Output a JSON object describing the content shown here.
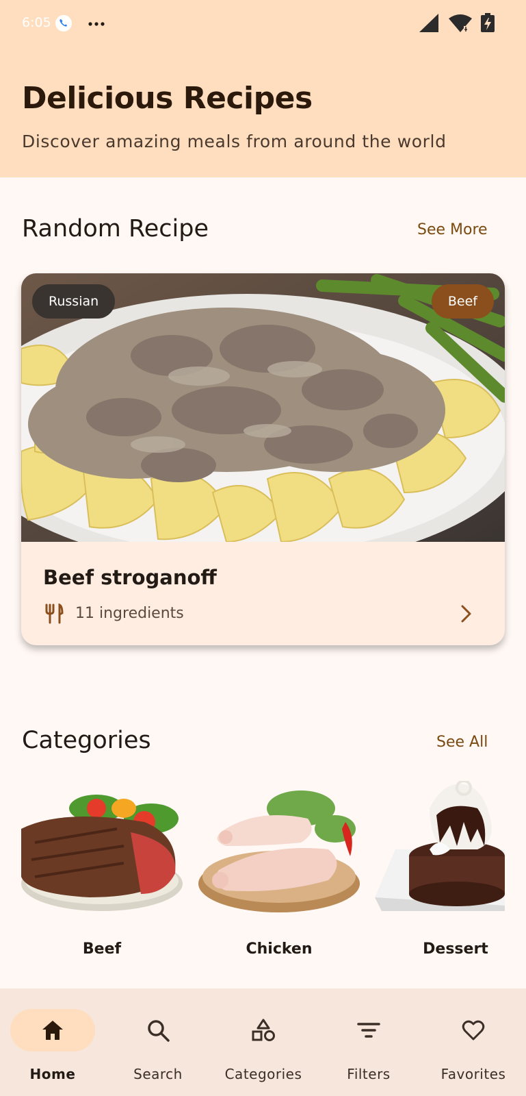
{
  "status_bar": {
    "time": "6:05",
    "icons": [
      "phone-call-icon",
      "more-dots-icon",
      "signal-icon",
      "wifi-icon",
      "battery-charging-icon"
    ]
  },
  "header": {
    "title": "Delicious Recipes",
    "subtitle": "Discover amazing meals from around the world"
  },
  "random_recipe": {
    "section_title": "Random Recipe",
    "see_more_label": "See More",
    "area_chip": "Russian",
    "category_chip": "Beef",
    "name": "Beef stroganoff",
    "ingredients": "11 ingredients"
  },
  "categories": {
    "section_title": "Categories",
    "see_all_label": "See All",
    "items": [
      {
        "label": "Beef"
      },
      {
        "label": "Chicken"
      },
      {
        "label": "Dessert"
      }
    ]
  },
  "bottom_nav": {
    "items": [
      {
        "label": "Home",
        "icon": "home-icon",
        "active": true
      },
      {
        "label": "Search",
        "icon": "search-icon",
        "active": false
      },
      {
        "label": "Categories",
        "icon": "shapes-icon",
        "active": false
      },
      {
        "label": "Filters",
        "icon": "filter-icon",
        "active": false
      },
      {
        "label": "Favorites",
        "icon": "heart-icon",
        "active": false
      }
    ]
  },
  "colors": {
    "header_bg": "#FFDDBF",
    "page_bg": "#FFF8F4",
    "accent": "#7A4A10",
    "chip_dark": "#3A3430",
    "chip_brown": "#8A4F1C",
    "nav_bg": "#F6E6DC"
  }
}
